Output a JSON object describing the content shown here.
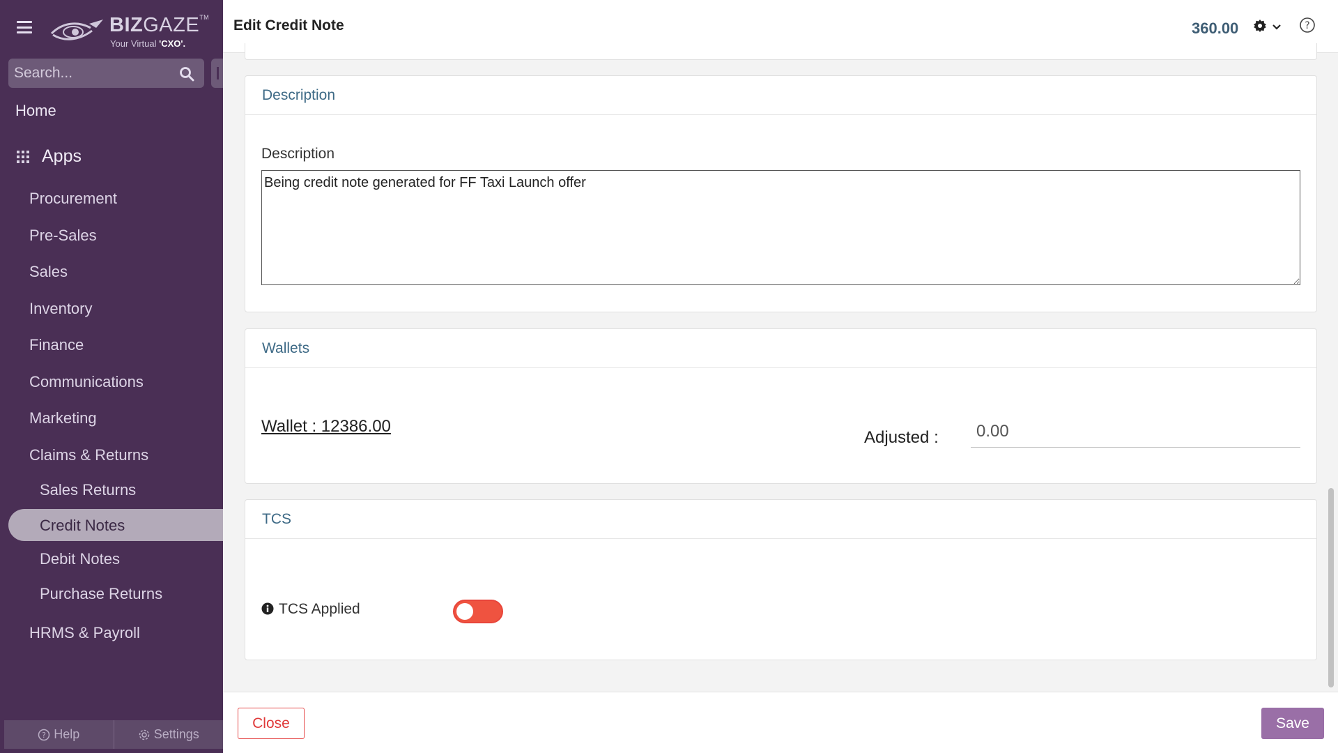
{
  "app": {
    "brand": "BIZGAZE",
    "tagline_prefix": "Your Virtual ",
    "tagline_highlight": "'CXO'.",
    "trademark": "TM"
  },
  "sidebar": {
    "search_placeholder": "Search...",
    "home": "Home",
    "apps": "Apps",
    "items": [
      "Procurement",
      "Pre-Sales",
      "Sales",
      "Inventory",
      "Finance",
      "Communications",
      "Marketing",
      "Claims & Returns"
    ],
    "sub_items": [
      "Sales Returns",
      "Credit Notes",
      "Debit Notes",
      "Purchase Returns"
    ],
    "active_item": "Credit Notes",
    "last_item": "HRMS & Payroll",
    "footer": {
      "help": "Help",
      "settings": "Settings"
    }
  },
  "header": {
    "title": "Edit Credit Note",
    "amount": "360.00"
  },
  "description_section": {
    "heading": "Description",
    "field_label": "Description",
    "value": "Being credit note generated for FF Taxi Launch offer"
  },
  "wallets_section": {
    "heading": "Wallets",
    "wallet_text": "Wallet : 12386.00",
    "adjusted_label": "Adjusted :",
    "adjusted_value": "0.00"
  },
  "tcs_section": {
    "heading": "TCS",
    "label": "TCS Applied",
    "toggle_on": false
  },
  "footer": {
    "close": "Close",
    "save": "Save"
  },
  "colors": {
    "sidebar_bg": "#4a2f55",
    "accent_title": "#3e6a86",
    "toggle_off": "#ef5340",
    "save_bg": "#9a6fa7",
    "close_border": "#e54b4b"
  }
}
